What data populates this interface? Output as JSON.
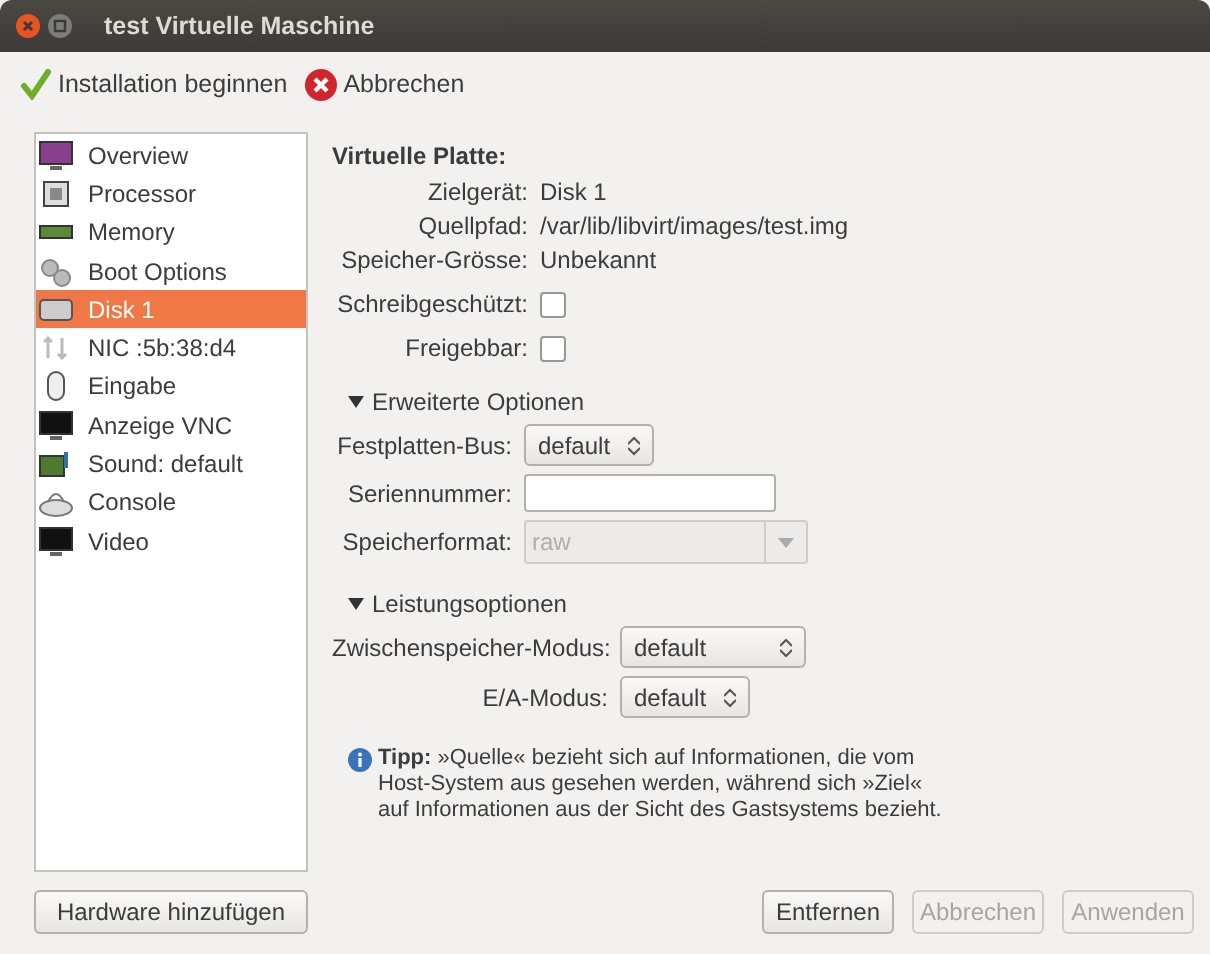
{
  "window": {
    "title": "test Virtuelle Maschine"
  },
  "toolbar": [
    {
      "label": "Installation beginnen",
      "kind": "check"
    },
    {
      "label": "Abbrechen",
      "kind": "cancel"
    }
  ],
  "sidebar": {
    "items": [
      {
        "label": "Overview",
        "selected": false
      },
      {
        "label": "Processor",
        "selected": false
      },
      {
        "label": "Memory",
        "selected": false
      },
      {
        "label": "Boot Options",
        "selected": false
      },
      {
        "label": "Disk 1",
        "selected": true
      },
      {
        "label": "NIC :5b:38:d4",
        "selected": false
      },
      {
        "label": "Eingabe",
        "selected": false
      },
      {
        "label": "Anzeige VNC",
        "selected": false
      },
      {
        "label": "Sound: default",
        "selected": false
      },
      {
        "label": "Console",
        "selected": false
      },
      {
        "label": "Video",
        "selected": false
      }
    ],
    "add_button": "Hardware hinzufügen"
  },
  "disk": {
    "heading": "Virtuelle Platte:",
    "fields": [
      {
        "label": "Zielgerät:",
        "value": "Disk 1"
      },
      {
        "label": "Quellpfad:",
        "value": "/var/lib/libvirt/images/test.img"
      },
      {
        "label": "Speicher-Grösse:",
        "value": "Unbekannt"
      }
    ],
    "checkboxes": [
      {
        "label": "Schreibgeschützt:",
        "checked": false
      },
      {
        "label": "Freigebbar:",
        "checked": false
      }
    ]
  },
  "advanced": {
    "title": "Erweiterte Optionen",
    "expanded": true,
    "bus": {
      "label": "Festplatten-Bus:",
      "value": "default"
    },
    "serial": {
      "label": "Seriennummer:"
    },
    "format": {
      "label": "Speicherformat:",
      "value": "raw",
      "disabled": true
    }
  },
  "performance": {
    "title": "Leistungsoptionen",
    "expanded": true,
    "cache": {
      "label": "Zwischenspeicher-Modus:",
      "value": "default"
    },
    "io": {
      "label": "E/A-Modus:",
      "value": "default"
    }
  },
  "tip": "**Tipp:** »Quelle« bezieht sich auf Informationen, die vom Host-System aus gesehen werden, während sich »Ziel« auf Informationen aus der Sicht des Gastsystems bezieht.",
  "buttons": [
    {
      "label": "Entfernen",
      "disabled": false
    },
    {
      "label": "Abbrechen",
      "disabled": true
    },
    {
      "label": "Anwenden",
      "disabled": true
    }
  ]
}
